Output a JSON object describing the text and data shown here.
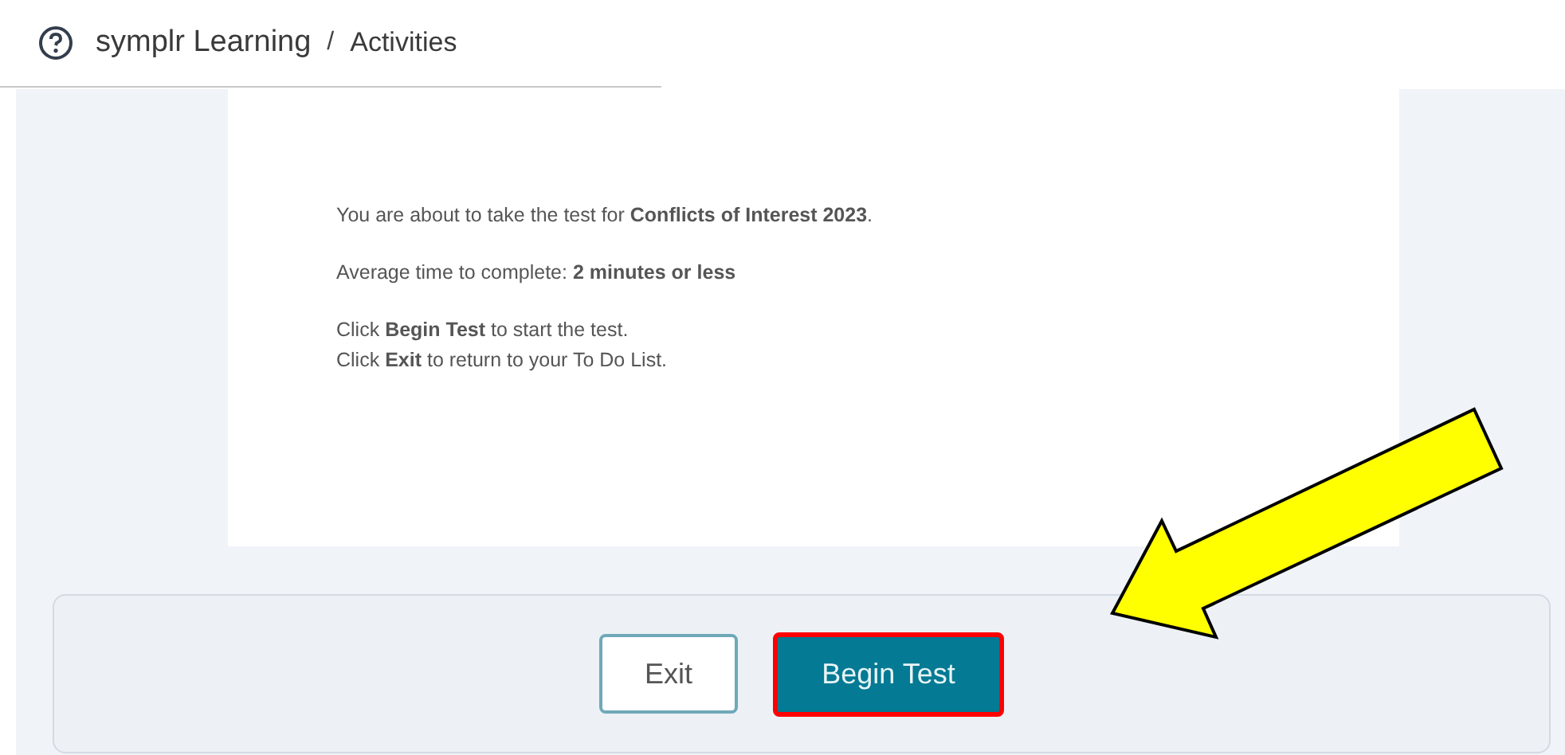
{
  "breadcrumb": [
    {
      "label": "symplr Learning"
    },
    {
      "label": "Activities"
    }
  ],
  "separator": "/",
  "message": {
    "paragraphs": [
      [
        "You are about to take the test for **Conflicts of Interest 2023**."
      ],
      [
        "Average time to complete: **2 minutes or less**"
      ],
      [
        "Click **Begin Test** to start the test.",
        "Click **Exit** to return to your To Do List."
      ]
    ]
  },
  "buttons": [
    {
      "label": "Exit",
      "kind": "secondary",
      "highlighted": false
    },
    {
      "label": "Begin Test",
      "kind": "primary",
      "highlighted": true
    }
  ],
  "annotation": {
    "kind": "arrow"
  }
}
